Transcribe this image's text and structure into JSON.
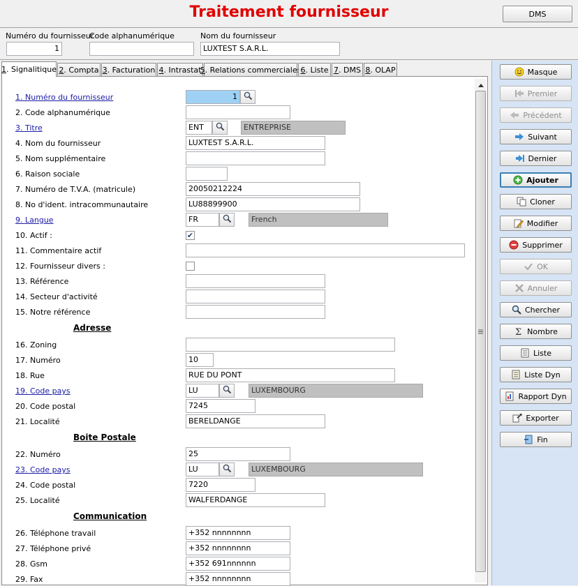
{
  "window": {
    "title": "Traitement fournisseur",
    "dms_button": "DMS"
  },
  "header": {
    "labels": {
      "supplier_no": "Numéro du fournisseur",
      "alpha_code": "Code alphanumérique",
      "supplier_name": "Nom du fournisseur"
    },
    "values": {
      "supplier_no": "1",
      "alpha_code": "",
      "supplier_name": "LUXTEST S.A.R.L."
    }
  },
  "tabs": [
    {
      "key": "1",
      "label": ". Signalitique"
    },
    {
      "key": "2",
      "label": ". Compta"
    },
    {
      "key": "3",
      "label": ". Facturation"
    },
    {
      "key": "4",
      "label": ". Intrastat"
    },
    {
      "key": "5",
      "label": ". Relations commerciales"
    },
    {
      "key": "6",
      "label": ". Liste"
    },
    {
      "key": "7",
      "label": ". DMS"
    },
    {
      "key": "8",
      "label": ". OLAP"
    }
  ],
  "form": {
    "labels": {
      "f1": "1. Numéro du fournisseur",
      "f2": "2. Code alphanumérique",
      "f3": "3. Titre",
      "f4": "4. Nom du fournisseur",
      "f5": "5. Nom supplémentaire",
      "f6": "6. Raison sociale",
      "f7": "7. Numéro de T.V.A. (matricule)",
      "f8": "8. No d'ident. intracommunautaire",
      "f9": "9. Langue",
      "f10": "10. Actif :",
      "f11": "11. Commentaire actif",
      "f12": "12. Fournisseur divers :",
      "f13": "13. Référence",
      "f14": "14. Secteur d'activité",
      "f15": "15. Notre référence",
      "f16": "16. Zoning",
      "f17": "17. Numéro",
      "f18": "18. Rue",
      "f19": "19. Code pays",
      "f20": "20. Code postal",
      "f21": "21. Localité",
      "f22": "22. Numéro",
      "f23": "23. Code pays",
      "f24": "24. Code postal",
      "f25": "25. Localité",
      "f26": "26. Téléphone travail",
      "f27": "27. Téléphone privé",
      "f28": "28. Gsm",
      "f29": "29. Fax"
    },
    "sections": {
      "address": "Adresse",
      "po_box": "Boite Postale",
      "communication": "Communication"
    },
    "values": {
      "f1": "1",
      "f2": "",
      "f3_code": "ENT",
      "f3_desc": "ENTREPRISE",
      "f4": "LUXTEST S.A.R.L.",
      "f5": "",
      "f6": "",
      "f7": "20050212224",
      "f8": "LU88899900",
      "f9_code": "FR",
      "f9_desc": "French",
      "f10_checked": true,
      "f11": "",
      "f12_checked": false,
      "f13": "",
      "f14": "",
      "f15": "",
      "f16": "",
      "f17": "10",
      "f18": "RUE DU PONT",
      "f19_code": "LU",
      "f19_desc": "LUXEMBOURG",
      "f20": "7245",
      "f21": "BERELDANGE",
      "f22": "25",
      "f23_code": "LU",
      "f23_desc": "LUXEMBOURG",
      "f24": "7220",
      "f25": "WALFERDANGE",
      "f26": "+352 nnnnnnnn",
      "f27": "+352 nnnnnnnn",
      "f28": "+352 691nnnnnn",
      "f29": "+352 nnnnnnnn"
    }
  },
  "actions": [
    {
      "name": "masque",
      "label": "Masque",
      "enabled": true,
      "icon": "smiley-icon"
    },
    {
      "name": "premier",
      "label": "Premier",
      "enabled": false,
      "icon": "first-icon"
    },
    {
      "name": "precedent",
      "label": "Précédent",
      "enabled": false,
      "icon": "previous-icon"
    },
    {
      "name": "suivant",
      "label": "Suivant",
      "enabled": true,
      "icon": "next-icon"
    },
    {
      "name": "dernier",
      "label": "Dernier",
      "enabled": true,
      "icon": "last-icon"
    },
    {
      "name": "ajouter",
      "label": "Ajouter",
      "enabled": true,
      "icon": "add-icon"
    },
    {
      "name": "cloner",
      "label": "Cloner",
      "enabled": true,
      "icon": "clone-icon"
    },
    {
      "name": "modifier",
      "label": "Modifier",
      "enabled": true,
      "icon": "edit-icon"
    },
    {
      "name": "supprimer",
      "label": "Supprimer",
      "enabled": true,
      "icon": "delete-icon"
    },
    {
      "name": "ok",
      "label": "OK",
      "enabled": false,
      "icon": "check-icon"
    },
    {
      "name": "annuler",
      "label": "Annuler",
      "enabled": false,
      "icon": "cancel-icon"
    },
    {
      "name": "chercher",
      "label": "Chercher",
      "enabled": true,
      "icon": "search-icon"
    },
    {
      "name": "nombre",
      "label": "Nombre",
      "enabled": true,
      "icon": "sigma-icon"
    },
    {
      "name": "liste",
      "label": "Liste",
      "enabled": true,
      "icon": "list-icon"
    },
    {
      "name": "liste-dyn",
      "label": "Liste Dyn",
      "enabled": true,
      "icon": "dynlist-icon"
    },
    {
      "name": "rapport-dyn",
      "label": "Rapport Dyn",
      "enabled": true,
      "icon": "report-icon"
    },
    {
      "name": "exporter",
      "label": "Exporter",
      "enabled": true,
      "icon": "export-icon"
    },
    {
      "name": "fin",
      "label": "Fin",
      "enabled": true,
      "icon": "exit-icon"
    }
  ],
  "colors": {
    "title": "#e00000",
    "link": "#1a1aa6",
    "sidebar": "#d6e4f5",
    "selected_field": "#9fd1f5"
  }
}
